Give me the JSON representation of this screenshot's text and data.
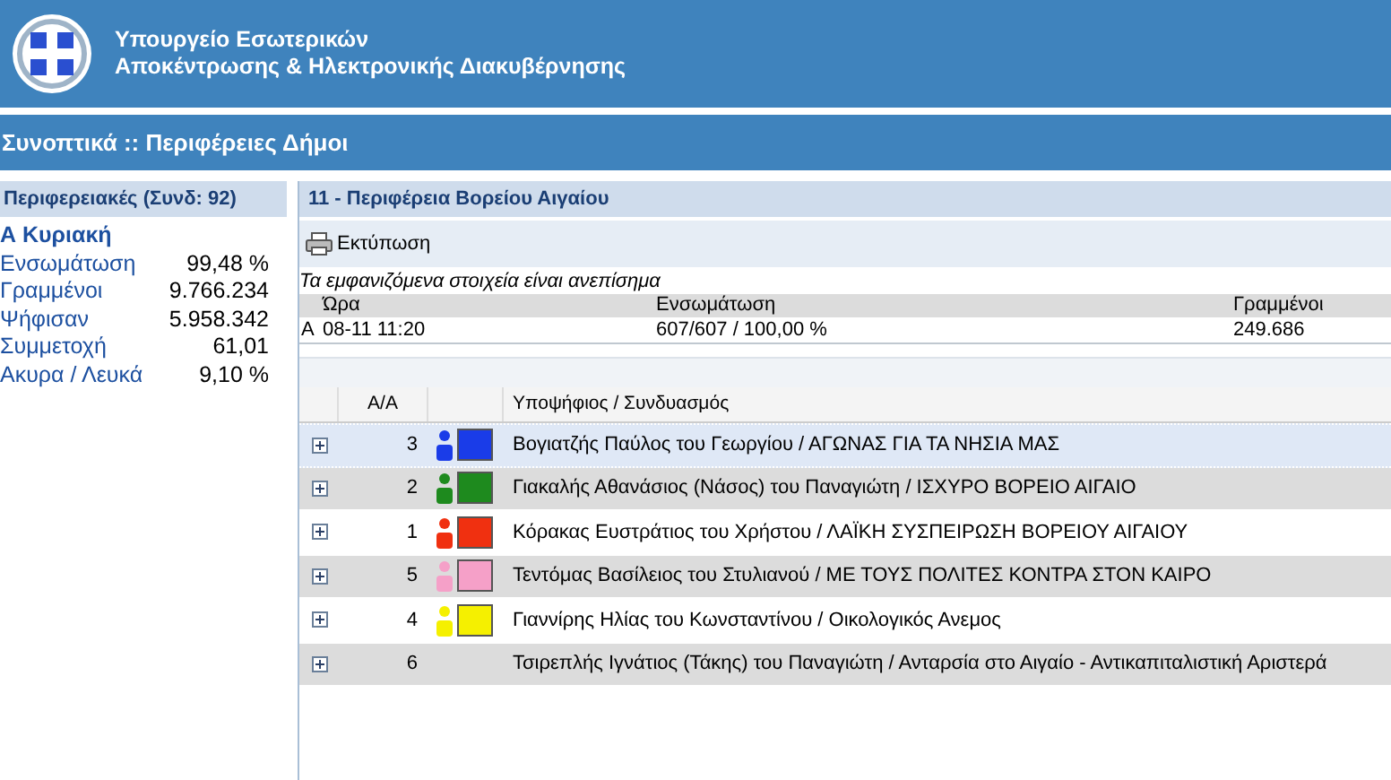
{
  "header": {
    "title_line_1": "Υπουργείο Εσωτερικών",
    "title_line_2": "Αποκέντρωσης & Ηλεκτρονικής Διακυβέρνησης"
  },
  "nav": {
    "title": "Συνοπτικά :: Περιφέρειες Δήμοι"
  },
  "sidebar": {
    "title": "Περιφερειακές (Συνδ: 92)",
    "subtitle": "Α Κυριακή",
    "stats": [
      {
        "label": "Ενσωμάτωση",
        "value": "99,48 %"
      },
      {
        "label": "Γραμμένοι",
        "value": "9.766.234"
      },
      {
        "label": "Ψήφισαν",
        "value": "5.958.342"
      },
      {
        "label": "Συμμετοχή",
        "value": "61,01"
      },
      {
        "label": "Ακυρα / Λευκά",
        "value": "9,10 %"
      }
    ]
  },
  "panel": {
    "title": "11 - Περιφέρεια Βορείου Αιγαίου",
    "print_button": "Εκτύπωση",
    "note": "Τα εμφανιζόμενα στοιχεία είναι ανεπίσημα",
    "summary": {
      "columns": [
        "",
        "Ώρα",
        "Ενσωμάτωση",
        "Γραμμένοι"
      ],
      "row": [
        "Α",
        "08-11 11:20",
        "607/607 / 100,00 %",
        "249.686"
      ]
    },
    "table": {
      "columns": [
        "Α/Α",
        "",
        "Υποψήφιος / Συνδυασμός"
      ],
      "rows": [
        {
          "number": "3",
          "name": "Βογιατζής Παύλος του Γεωργίου / ΑΓΩΝΑΣ ΓΙΑ ΤΑ ΝΗΣΙΑ ΜΑΣ",
          "color": "#1a3ce8",
          "selected": true
        },
        {
          "number": "2",
          "name": "Γιακαλής Αθανάσιος (Νάσος) του Παναγιώτη / ΙΣΧΥΡΟ ΒΟΡΕΙΟ ΑΙΓΑΙΟ",
          "color": "#1e8a1e",
          "selected": false
        },
        {
          "number": "1",
          "name": "Κόρακας Ευστράτιος του Χρήστου / ΛΑΪΚΗ ΣΥΣΠΕΙΡΩΣΗ ΒΟΡΕΙΟΥ ΑΙΓΑΙΟΥ",
          "color": "#f03010",
          "selected": false
        },
        {
          "number": "5",
          "name": "Τεντόμας Βασίλειος του Στυλιανού / ΜΕ ΤΟΥΣ ΠΟΛΙΤΕΣ ΚΟΝΤΡΑ ΣΤΟΝ ΚΑΙΡΟ",
          "color": "#f5a0c8",
          "selected": false
        },
        {
          "number": "4",
          "name": "Γιαννίρης Ηλίας του Κωνσταντίνου / Οικολογικός Ανεμος",
          "color": "#f5f000",
          "selected": false
        },
        {
          "number": "6",
          "name": "Τσιρεπλής Ιγνάτιος (Τάκης) του Παναγιώτη / Ανταρσία στο Αιγαίο - Αντικαπιταλιστική Αριστερά",
          "selected": false
        }
      ]
    }
  }
}
